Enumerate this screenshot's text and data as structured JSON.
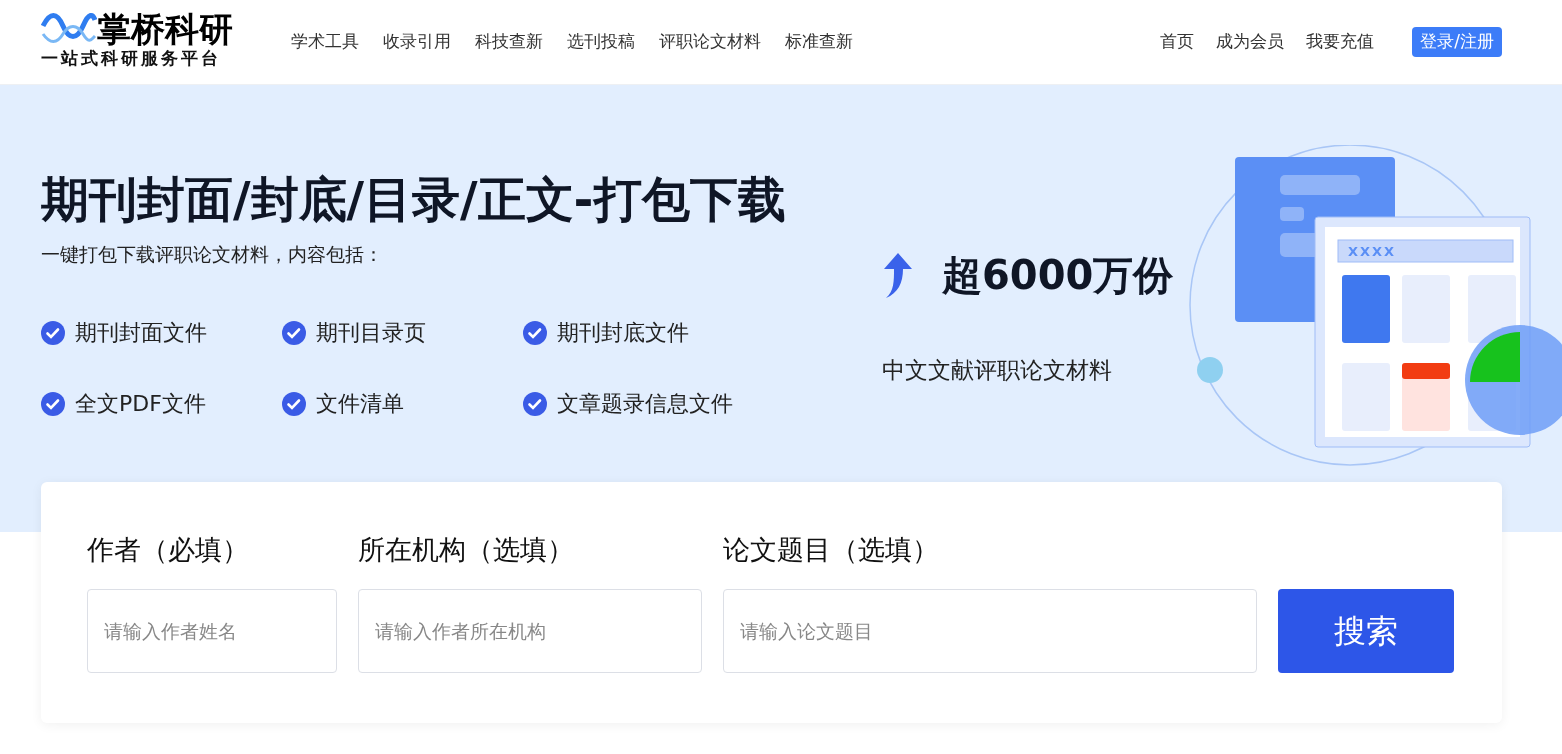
{
  "header": {
    "logo": {
      "name": "掌桥科研",
      "slogan": "一站式科研服务平台"
    },
    "nav": [
      {
        "label": "学术工具"
      },
      {
        "label": "收录引用"
      },
      {
        "label": "科技查新"
      },
      {
        "label": "选刊投稿"
      },
      {
        "label": "评职论文材料"
      },
      {
        "label": "标准查新"
      }
    ],
    "user_links": [
      {
        "label": "首页"
      },
      {
        "label": "成为会员"
      },
      {
        "label": "我要充值"
      }
    ],
    "login_button": "登录/注册"
  },
  "hero": {
    "title": "期刊封面/封底/目录/正文-打包下载",
    "subtitle": "一键打包下载评职论文材料，内容包括：",
    "features": [
      {
        "label": "期刊封面文件",
        "checked": true
      },
      {
        "label": "期刊目录页",
        "checked": true
      },
      {
        "label": "期刊封底文件",
        "checked": true
      },
      {
        "label": "全文PDF文件",
        "checked": true
      },
      {
        "label": "文件清单",
        "checked": true
      },
      {
        "label": "文章题录信息文件",
        "checked": true
      }
    ],
    "stat": "超6000万份",
    "stat_caption": "中文文献评职论文材料",
    "illustration_label": "XXXX"
  },
  "search": {
    "fields": [
      {
        "label": "作者（必填）",
        "placeholder": "请输入作者姓名"
      },
      {
        "label": "所在机构（选填）",
        "placeholder": "请输入作者所在机构"
      },
      {
        "label": "论文题目（选填）",
        "placeholder": "请输入论文题目"
      }
    ],
    "button": "搜索"
  }
}
